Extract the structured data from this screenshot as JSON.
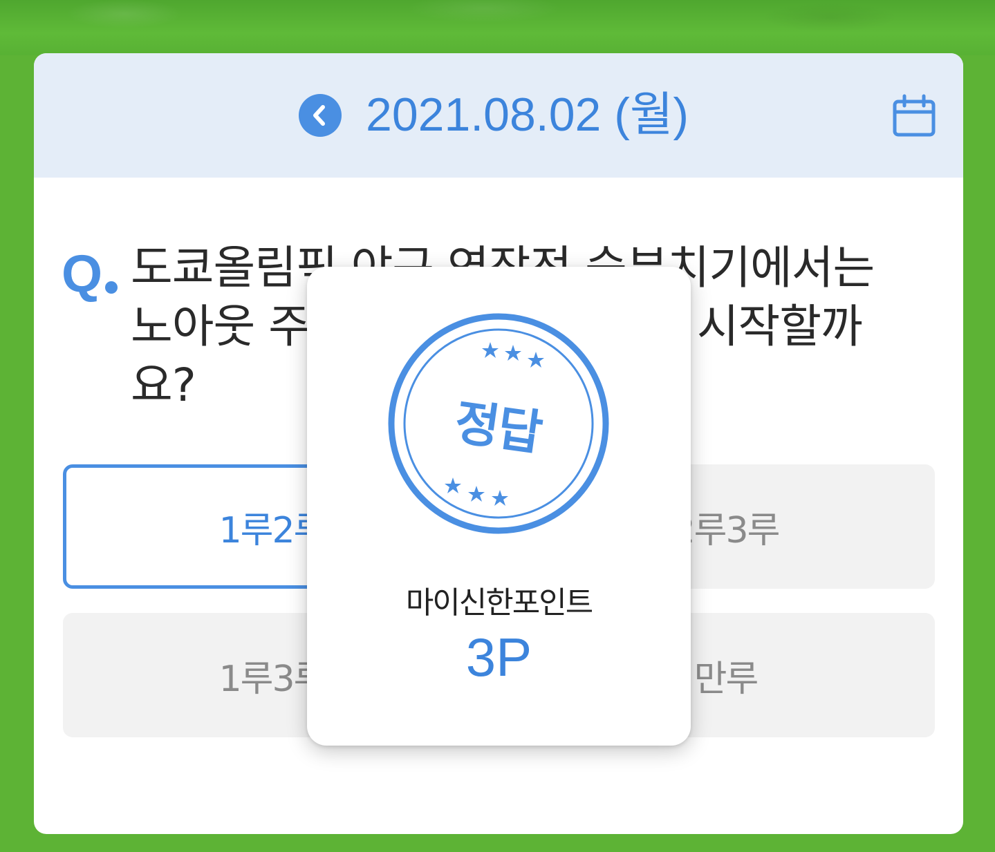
{
  "header": {
    "date": "2021.08.02 (월)",
    "prev_icon": "chevron-left-icon",
    "calendar_icon": "calendar-icon"
  },
  "quiz": {
    "q_mark": "Q",
    "question": "도쿄올림픽 야구 연장전 승부치기에서는 노아웃 주자 1루2루 상황에서 시작할까요?"
  },
  "answers": [
    {
      "label": "1루2루",
      "selected": true
    },
    {
      "label": "2루3루",
      "selected": false
    },
    {
      "label": "1루3루",
      "selected": false
    },
    {
      "label": "만루",
      "selected": false
    }
  ],
  "popup": {
    "stamp_text": "정답",
    "point_label": "마이신한포인트",
    "point_value": "3P"
  },
  "colors": {
    "accent": "#4a8fe2",
    "header_bg": "#e4edf8",
    "grass": "#5db335"
  }
}
